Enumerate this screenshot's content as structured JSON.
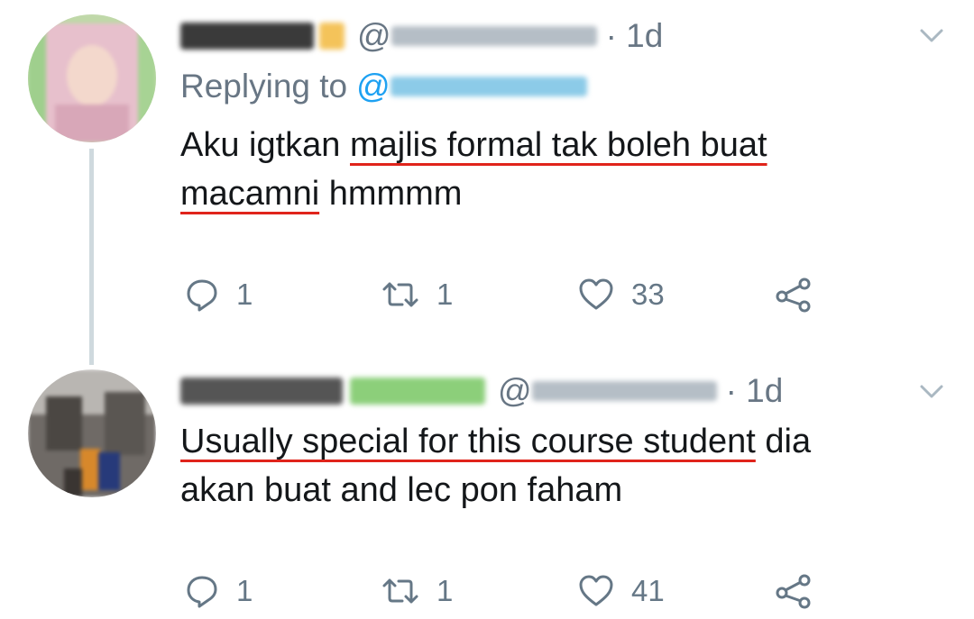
{
  "tweets": [
    {
      "display_name": "",
      "handle_prefix": "@",
      "time": "· 1d",
      "replying_label": "Replying to",
      "replying_at": "@",
      "text_line1_underlined": "Aku igtkan majlis formal tak boleh buat",
      "text_line1_prefix": "Aku igtkan ",
      "text_line1_ul": "majlis formal tak boleh buat",
      "text_line2_ul": "macamni",
      "text_line2_rest": " hmmmm",
      "reply_count": "1",
      "retweet_count": "1",
      "like_count": "33"
    },
    {
      "display_name": "",
      "handle_prefix": "@",
      "time": "· 1d",
      "text_line1_ul": "Usually special for this course student",
      "text_line1_rest": " dia",
      "text_line2": "akan buat and lec pon faham",
      "reply_count": "1",
      "retweet_count": "1",
      "like_count": "41"
    }
  ],
  "icons": [
    "reply-icon",
    "retweet-icon",
    "like-icon",
    "share-icon",
    "chevron-down-icon"
  ],
  "colors": {
    "text": "#14171a",
    "secondary": "#687684",
    "link": "#1da1f2",
    "underline": "#e0241b",
    "thread_line": "#cfd9de"
  }
}
